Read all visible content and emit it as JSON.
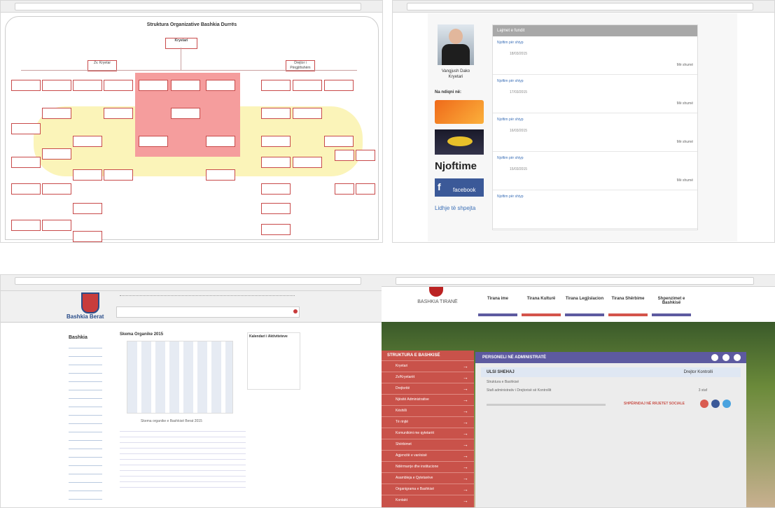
{
  "panes": {
    "top_left": {
      "title": "Struktura Organizative Bashkia Durrës",
      "root": "Kryetari",
      "left_node": "Zv. Kryetar",
      "right_node": "Drejtor i Përgjithshëm"
    },
    "top_right": {
      "person_name": "Vangjush Dako",
      "person_role": "Kryetari",
      "follow_label": "Na ndiqni në:",
      "njoftime_label": "Njoftime",
      "facebook_label": "facebook",
      "panel_header": "Lajmet e fundit",
      "footer_link": "Lidhje të shpejta",
      "news": [
        {
          "title": "Njoftim për shtyp",
          "date": "18/03/2015",
          "more": "Më shumë"
        },
        {
          "title": "Njoftim për shtyp",
          "date": "17/03/2015",
          "more": "Më shumë"
        },
        {
          "title": "Njoftim për shtyp",
          "date": "16/03/2015",
          "more": "Më shumë"
        },
        {
          "title": "Njoftim për shtyp",
          "date": "15/03/2015",
          "more": "Më shumë"
        },
        {
          "title": "Njoftim për shtyp",
          "date": "",
          "more": ""
        }
      ]
    },
    "bottom_left": {
      "logo_text": "Bashkia Berat",
      "sidebar_title": "Bashkia",
      "chart_title": "Skema Organike 2015",
      "side_title": "Kalendari i Aktiviteteve",
      "caption": "Skema organike e Bashkisë Berat 2015"
    },
    "bottom_right": {
      "logo_text": "BASHKIA TIRANË",
      "tabs": [
        {
          "label": "Tirana ime",
          "color": "#5d5aa0"
        },
        {
          "label": "Tirana Kulturë",
          "color": "#d4544b"
        },
        {
          "label": "Tirana Legjislacion",
          "color": "#5d5aa0"
        },
        {
          "label": "Tirana Shërbime",
          "color": "#d4544b"
        },
        {
          "label": "Shpenzimet e Bashkisë",
          "color": "#5d5aa0"
        }
      ],
      "sidebar_header": "STRUKTURA E BASHKISË",
      "sidebar_items": [
        "Kryetari",
        "Zv/Kryetarët",
        "Drejtoritë",
        "Njësitë Administrative",
        "Këshilli",
        "Të rinjtë",
        "Komunikimi me qytetarët",
        "Shërbimet",
        "Agjencitë e varësisë",
        "Ndërmarrje dhe institucione",
        "Asambleja e Qytetarëve",
        "Organigrama e Bashkisë",
        "Kontakt"
      ],
      "panel_title": "PERSONELI NË ADMINISTRATË",
      "row_title": "ULSI SHEHAJ",
      "row_value": "Drejtor Kontrolli",
      "row_sub": "Struktura e Bashkisë",
      "row_detail": "Stafi administrativ i Drejtorisë së Kontrollit",
      "row_count": "3 staf",
      "footer_text": "SHPËRNDAJ NË RRJETET SOCIALE"
    }
  }
}
